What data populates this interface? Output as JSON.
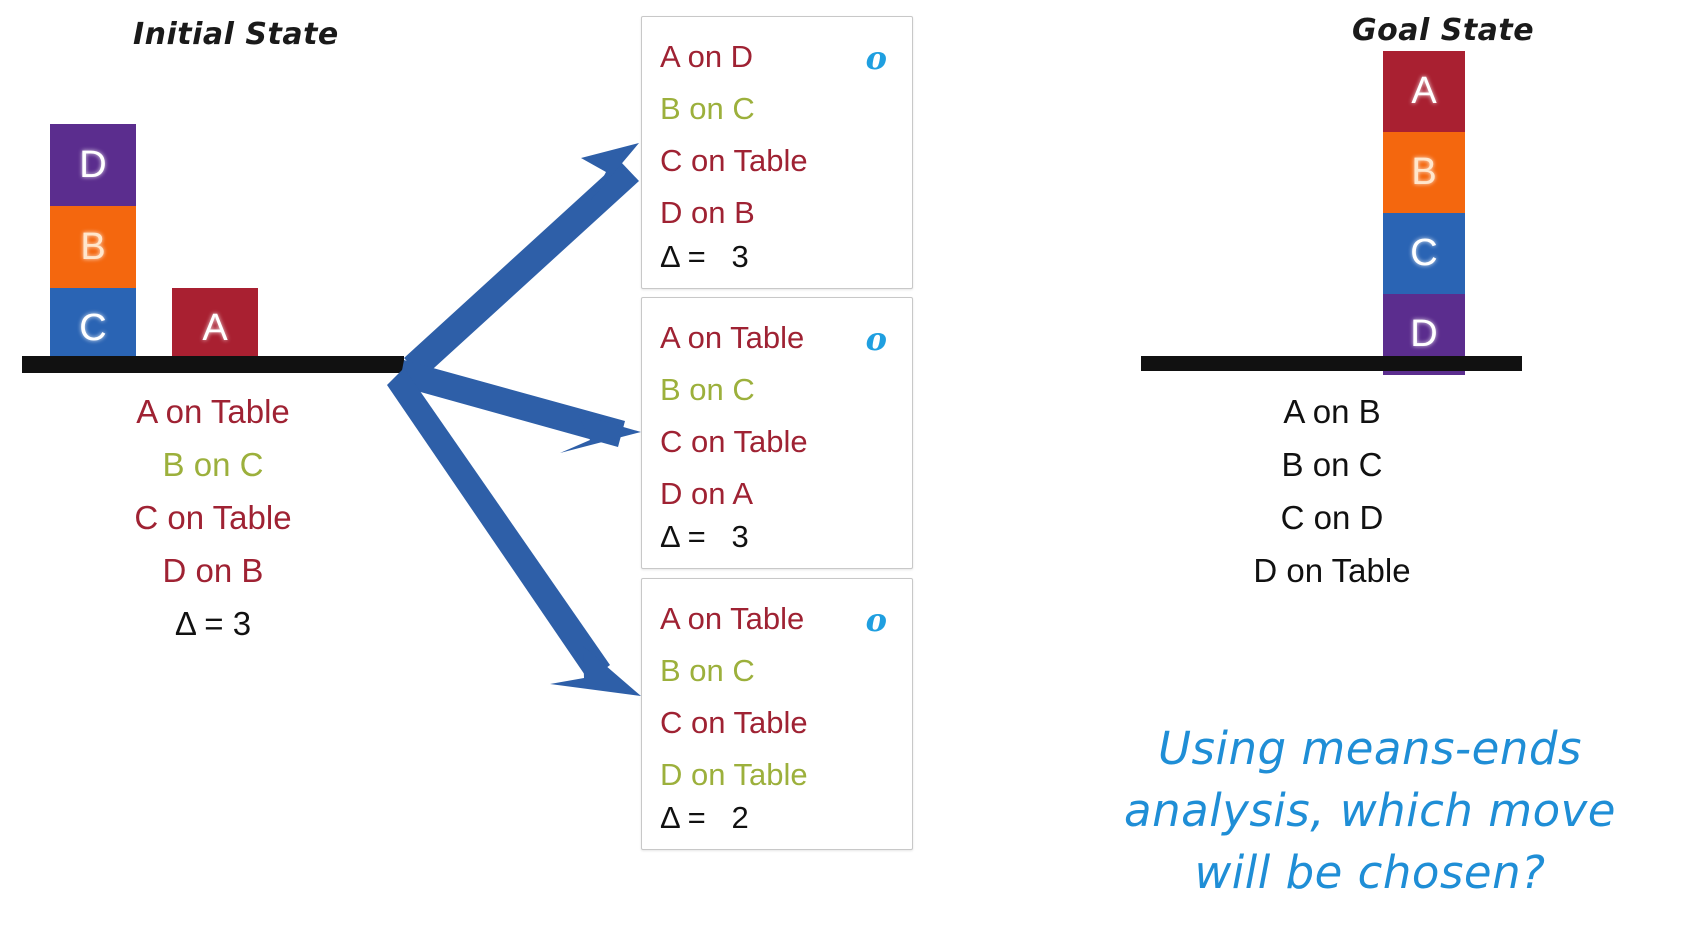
{
  "headings": {
    "initial": "Initial State",
    "goal": "Goal State"
  },
  "colors": {
    "block_a": "#a92031",
    "block_b": "#f4670e",
    "block_c": "#2a64b4",
    "block_d": "#5b2d8e",
    "arrow_blue": "#2e5fa8",
    "operator_blue": "#1f9fe0",
    "question_blue": "#1f8ed6",
    "predicate_red": "#9f2233",
    "predicate_green": "#9cb03c",
    "table_black": "#111111"
  },
  "initial_state": {
    "blocks": [
      {
        "label": "D",
        "color_key": "block_d"
      },
      {
        "label": "B",
        "color_key": "block_b"
      },
      {
        "label": "C",
        "color_key": "block_c"
      },
      {
        "label": "A",
        "color_key": "block_a"
      }
    ],
    "predicates": [
      {
        "text": "A on Table",
        "color": "red"
      },
      {
        "text": "B on C",
        "color": "green"
      },
      {
        "text": "C on Table",
        "color": "red"
      },
      {
        "text": "D on B",
        "color": "red"
      }
    ],
    "delta_label": "Δ = 3"
  },
  "goal_state": {
    "blocks": [
      {
        "label": "A",
        "color_key": "block_a"
      },
      {
        "label": "B",
        "color_key": "block_b"
      },
      {
        "label": "C",
        "color_key": "block_c"
      },
      {
        "label": "D",
        "color_key": "block_d"
      }
    ],
    "predicates": [
      {
        "text": "A on B",
        "color": "black"
      },
      {
        "text": "B on C",
        "color": "black"
      },
      {
        "text": "C on D",
        "color": "black"
      },
      {
        "text": "D on Table",
        "color": "black"
      }
    ]
  },
  "successor_states": [
    {
      "id": "box-1",
      "operator_marker": "o",
      "predicates": [
        {
          "text": "A on D",
          "color": "red"
        },
        {
          "text": "B on C",
          "color": "green"
        },
        {
          "text": "C on Table",
          "color": "red"
        },
        {
          "text": "D on B",
          "color": "red"
        }
      ],
      "delta_label": "Δ =   3",
      "delta_value": 3
    },
    {
      "id": "box-2",
      "operator_marker": "o",
      "predicates": [
        {
          "text": "A on Table",
          "color": "red"
        },
        {
          "text": "B on C",
          "color": "green"
        },
        {
          "text": "C on Table",
          "color": "red"
        },
        {
          "text": "D on A",
          "color": "red"
        }
      ],
      "delta_label": "Δ =   3",
      "delta_value": 3
    },
    {
      "id": "box-3",
      "operator_marker": "o",
      "predicates": [
        {
          "text": "A on Table",
          "color": "red"
        },
        {
          "text": "B on C",
          "color": "green"
        },
        {
          "text": "C on Table",
          "color": "red"
        },
        {
          "text": "D on Table",
          "color": "green"
        }
      ],
      "delta_label": "Δ =   2",
      "delta_value": 2
    }
  ],
  "question": {
    "lines": [
      "Using means-ends",
      "analysis, which move",
      "will be chosen?"
    ],
    "full_text": "Using means-ends analysis, which move will be chosen?"
  }
}
